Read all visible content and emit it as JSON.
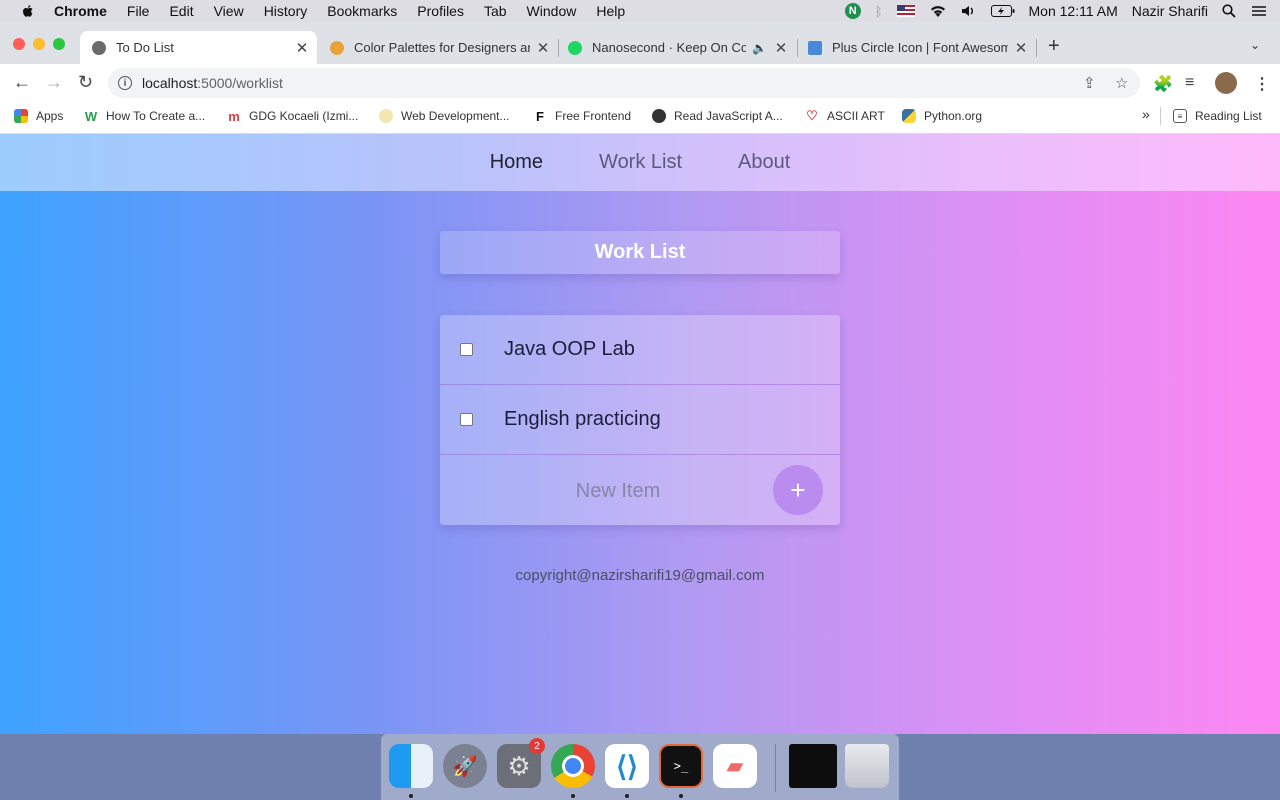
{
  "menubar": {
    "app": "Chrome",
    "items": [
      "File",
      "Edit",
      "View",
      "History",
      "Bookmarks",
      "Profiles",
      "Tab",
      "Window",
      "Help"
    ],
    "clock": "Mon 12:11 AM",
    "user": "Nazir Sharifi"
  },
  "tabs": [
    {
      "title": "To Do List",
      "active": true
    },
    {
      "title": "Color Palettes for Designers an"
    },
    {
      "title": "Nanosecond · Keep On Co"
    },
    {
      "title": "Plus Circle Icon | Font Awesom"
    }
  ],
  "omnibox": {
    "host": "localhost",
    "path": ":5000/worklist"
  },
  "bookmarks": [
    {
      "label": "Apps"
    },
    {
      "label": "How To Create a..."
    },
    {
      "label": "GDG Kocaeli (Izmi..."
    },
    {
      "label": "Web Development..."
    },
    {
      "label": "Free Frontend"
    },
    {
      "label": "Read JavaScript A..."
    },
    {
      "label": "ASCII ART"
    },
    {
      "label": "Python.org"
    }
  ],
  "reading_list": "Reading List",
  "nav": {
    "home": "Home",
    "worklist": "Work List",
    "about": "About"
  },
  "page_title": "Work List",
  "items": [
    {
      "text": "Java OOP Lab",
      "checked": false
    },
    {
      "text": "English practicing",
      "checked": false
    }
  ],
  "new_item": {
    "placeholder": "New Item",
    "button": "+"
  },
  "footer": "copyright@nazirsharifi19@gmail.com",
  "dock": {
    "badge": "2"
  }
}
